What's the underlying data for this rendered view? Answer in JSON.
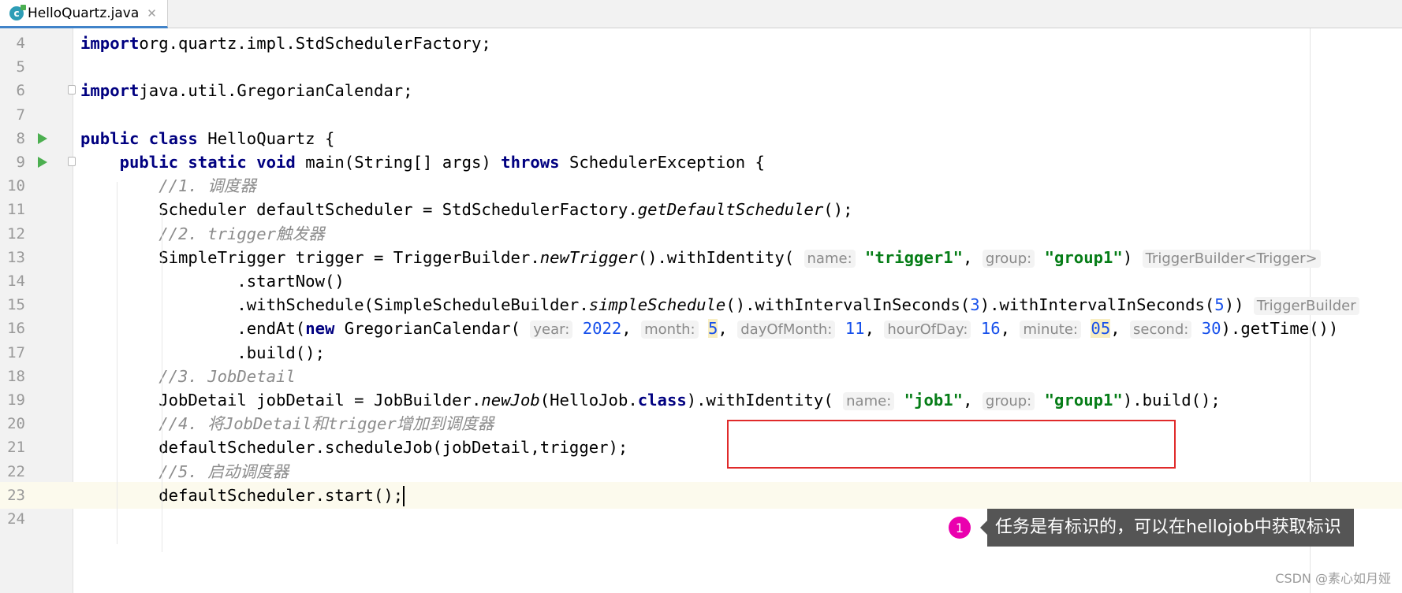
{
  "tab": {
    "filename": "HelloQuartz.java",
    "icon_letter": "c"
  },
  "lines": [
    {
      "number": "4",
      "tokens": [
        [
          "kw",
          "import"
        ],
        [
          "",
          "org.quartz.impl.StdSchedulerFactory;"
        ]
      ]
    },
    {
      "number": "5",
      "tokens": []
    },
    {
      "number": "6",
      "tokens": [
        [
          "kw",
          "import"
        ],
        [
          "",
          "java.util.GregorianCalendar;"
        ]
      ]
    },
    {
      "number": "7",
      "tokens": []
    },
    {
      "number": "8",
      "tokens": [
        [
          "kw",
          "public class"
        ],
        [
          "",
          " HelloQuartz {"
        ]
      ]
    },
    {
      "number": "9",
      "tokens": [
        [
          "",
          "    "
        ],
        [
          "kw",
          "public static void"
        ],
        [
          "",
          " main(String[] args) "
        ],
        [
          "kw",
          "throws"
        ],
        [
          "",
          " SchedulerException {"
        ]
      ]
    },
    {
      "number": "10",
      "tokens": [
        [
          "",
          "        "
        ],
        [
          "cmt",
          "//1. 调度器"
        ]
      ]
    },
    {
      "number": "11",
      "tokens": [
        [
          "",
          "        Scheduler defaultScheduler = StdSchedulerFactory."
        ],
        [
          "it",
          "getDefaultScheduler"
        ],
        [
          "",
          "();"
        ]
      ]
    },
    {
      "number": "12",
      "tokens": [
        [
          "",
          "        "
        ],
        [
          "cmt",
          "//2. trigger触发器"
        ]
      ]
    },
    {
      "number": "13",
      "tokens": [
        [
          "",
          "        SimpleTrigger trigger = TriggerBuilder."
        ],
        [
          "it",
          "newTrigger"
        ],
        [
          "",
          "().withIdentity( "
        ],
        [
          "hint",
          "name:"
        ],
        [
          "",
          " "
        ],
        [
          "str",
          "\"trigger1\""
        ],
        [
          "",
          ", "
        ],
        [
          "hint",
          "group:"
        ],
        [
          "",
          " "
        ],
        [
          "str",
          "\"group1\""
        ],
        [
          "",
          ") "
        ],
        [
          "hint",
          "TriggerBuilder<Trigger>"
        ]
      ]
    },
    {
      "number": "14",
      "tokens": [
        [
          "",
          "                .startNow()"
        ]
      ]
    },
    {
      "number": "15",
      "tokens": [
        [
          "",
          "                .withSchedule(SimpleScheduleBuilder."
        ],
        [
          "it",
          "simpleSchedule"
        ],
        [
          "",
          "().withIntervalInSeconds("
        ],
        [
          "num",
          "3"
        ],
        [
          "",
          ").withIntervalInSeconds("
        ],
        [
          "num",
          "5"
        ],
        [
          "",
          ")) "
        ],
        [
          "hint",
          "TriggerBuilder"
        ]
      ]
    },
    {
      "number": "16",
      "tokens": [
        [
          "",
          "                ."
        ],
        [
          "",
          "endAt("
        ],
        [
          "kw",
          "new"
        ],
        [
          "",
          " GregorianCalendar( "
        ],
        [
          "hint",
          "year:"
        ],
        [
          "",
          " "
        ],
        [
          "num",
          "2022"
        ],
        [
          "",
          ", "
        ],
        [
          "hint",
          "month:"
        ],
        [
          "",
          " "
        ],
        [
          "numhl",
          "5"
        ],
        [
          "",
          ", "
        ],
        [
          "hint",
          "dayOfMonth:"
        ],
        [
          "",
          " "
        ],
        [
          "num",
          "11"
        ],
        [
          "",
          ", "
        ],
        [
          "hint",
          "hourOfDay:"
        ],
        [
          "",
          " "
        ],
        [
          "num",
          "16"
        ],
        [
          "",
          ", "
        ],
        [
          "hint",
          "minute:"
        ],
        [
          "",
          " "
        ],
        [
          "numhl",
          "05"
        ],
        [
          "",
          ", "
        ],
        [
          "hint",
          "second:"
        ],
        [
          "",
          " "
        ],
        [
          "num",
          "30"
        ],
        [
          "",
          ").getTime())"
        ]
      ]
    },
    {
      "number": "17",
      "tokens": [
        [
          "",
          "                .build();"
        ]
      ]
    },
    {
      "number": "18",
      "tokens": [
        [
          "",
          "        "
        ],
        [
          "cmt",
          "//3. JobDetail"
        ]
      ]
    },
    {
      "number": "19",
      "tokens": [
        [
          "",
          "        JobDetail jobDetail = JobBuilder."
        ],
        [
          "it",
          "newJob"
        ],
        [
          "",
          "(HelloJob."
        ],
        [
          "kw",
          "class"
        ],
        [
          "",
          ").withIdentity( "
        ],
        [
          "hint",
          "name:"
        ],
        [
          "",
          " "
        ],
        [
          "str",
          "\"job1\""
        ],
        [
          "",
          ", "
        ],
        [
          "hint",
          "group:"
        ],
        [
          "",
          " "
        ],
        [
          "str",
          "\"group1\""
        ],
        [
          "",
          ").build();"
        ]
      ]
    },
    {
      "number": "20",
      "tokens": [
        [
          "",
          "        "
        ],
        [
          "cmt",
          "//4. 将JobDetail和trigger增加到调度器"
        ]
      ]
    },
    {
      "number": "21",
      "tokens": [
        [
          "",
          "        defaultScheduler.scheduleJob(jobDetail,trigger);"
        ]
      ]
    },
    {
      "number": "22",
      "tokens": [
        [
          "",
          "        "
        ],
        [
          "cmt",
          "//5. 启动调度器"
        ]
      ]
    },
    {
      "number": "23",
      "tokens": [
        [
          "",
          "        defaultScheduler.start();"
        ]
      ]
    },
    {
      "number": "24",
      "tokens": []
    }
  ],
  "current_line": "23",
  "run_lines": [
    "8",
    "9"
  ],
  "fold_lines": [
    "6",
    "9"
  ],
  "annotation": {
    "badge": "1",
    "text": "任务是有标识的，可以在hellojob中获取标识"
  },
  "watermark": "CSDN @素心如月娅",
  "colors": {
    "keyword": "#000080",
    "string": "#067d17",
    "number": "#1750eb",
    "comment": "#8c8c8c",
    "highlight_box": "#e02a2a",
    "badge": "#ea00ae"
  }
}
